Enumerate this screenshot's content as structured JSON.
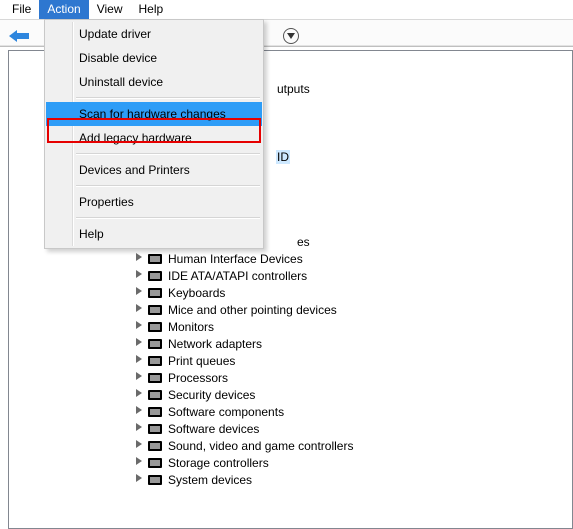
{
  "menubar": {
    "file": "File",
    "action": "Action",
    "view": "View",
    "help": "Help"
  },
  "action_menu": {
    "update_driver": "Update driver",
    "disable_device": "Disable device",
    "uninstall_device": "Uninstall device",
    "scan_hw": "Scan for hardware changes",
    "add_legacy": "Add legacy hardware",
    "dev_printers": "Devices and Printers",
    "properties": "Properties",
    "help": "Help"
  },
  "tree_peek": {
    "audio_outputs_tail": "utputs",
    "selected_tail": "ID",
    "es_tail": "es"
  },
  "devices": [
    {
      "label": "Human Interface Devices",
      "icon": "hid-icon"
    },
    {
      "label": "IDE ATA/ATAPI controllers",
      "icon": "ide-icon"
    },
    {
      "label": "Keyboards",
      "icon": "keyboard-icon"
    },
    {
      "label": "Mice and other pointing devices",
      "icon": "mouse-icon"
    },
    {
      "label": "Monitors",
      "icon": "monitor-icon"
    },
    {
      "label": "Network adapters",
      "icon": "network-icon"
    },
    {
      "label": "Print queues",
      "icon": "printer-icon"
    },
    {
      "label": "Processors",
      "icon": "cpu-icon"
    },
    {
      "label": "Security devices",
      "icon": "security-icon"
    },
    {
      "label": "Software components",
      "icon": "software-comp-icon"
    },
    {
      "label": "Software devices",
      "icon": "software-dev-icon"
    },
    {
      "label": "Sound, video and game controllers",
      "icon": "sound-icon"
    },
    {
      "label": "Storage controllers",
      "icon": "storage-icon"
    },
    {
      "label": "System devices",
      "icon": "system-icon"
    }
  ]
}
